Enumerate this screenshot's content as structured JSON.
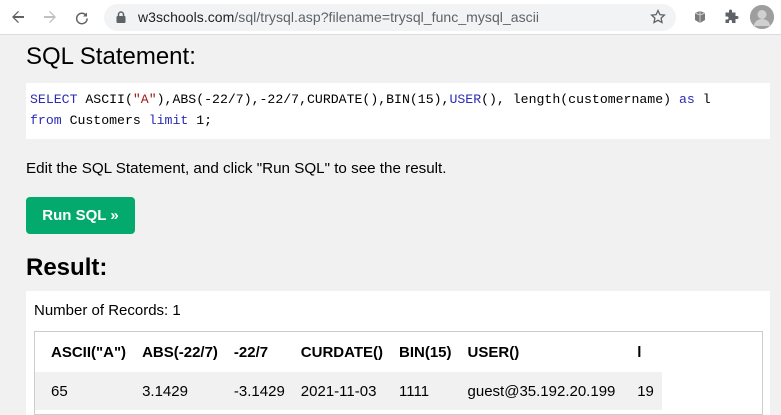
{
  "browser": {
    "url_host": "w3schools.com",
    "url_path": "/sql/trysql.asp?filename=trysql_func_mysql_ascii",
    "back_icon": "arrow-left-icon",
    "forward_icon": "arrow-right-icon",
    "reload_icon": "reload-icon",
    "lock_icon": "lock-icon",
    "star_icon": "star-icon",
    "extension_icon": "extension-icon",
    "puzzle_icon": "puzzle-icon"
  },
  "statement": {
    "heading": "SQL Statement:",
    "line1": {
      "kw_select": "SELECT",
      "p1": " ASCII(",
      "str_a": "\"A\"",
      "p2": "),ABS(-22/7),-22/7,CURDATE(),BIN(15),",
      "kw_user": "USER",
      "p3": "(), length(customername) ",
      "kw_as": "as",
      "p4": " l"
    },
    "line2": {
      "kw_from": "from",
      "p1": " Customers ",
      "kw_limit": "limit",
      "p2": " 1;"
    }
  },
  "instruction": "Edit the SQL Statement, and click \"Run SQL\" to see the result.",
  "run_button": "Run SQL »",
  "result": {
    "heading": "Result:",
    "records_label": "Number of Records: 1",
    "columns": [
      "ASCII(\"A\")",
      "ABS(-22/7)",
      "-22/7",
      "CURDATE()",
      "BIN(15)",
      "USER()",
      "l"
    ],
    "rows": [
      [
        "65",
        "3.1429",
        "-3.1429",
        "2021-11-03",
        "1111",
        "guest@35.192.20.199",
        "19"
      ]
    ]
  },
  "colors": {
    "keyword": "#2b2bb5",
    "string": "#a31515",
    "run_button": "#04aa6d",
    "page_bg": "#f1f1f1"
  }
}
